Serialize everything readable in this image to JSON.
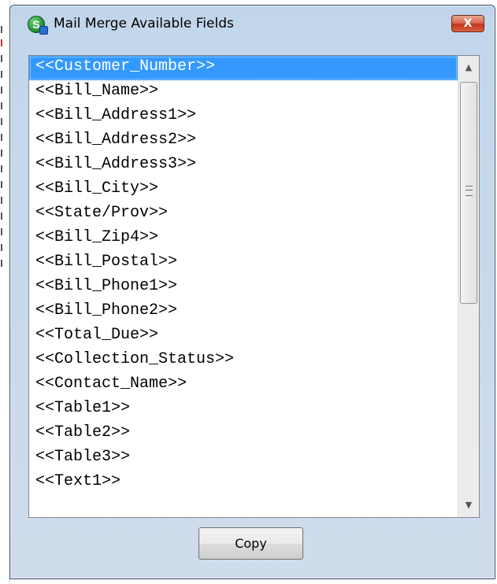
{
  "window": {
    "title": "Mail Merge Available Fields",
    "app_icon_letter": "S",
    "close_glyph": "X"
  },
  "fields": [
    "<<Customer_Number>>",
    "<<Bill_Name>>",
    "<<Bill_Address1>>",
    "<<Bill_Address2>>",
    "<<Bill_Address3>>",
    "<<Bill_City>>",
    "<<State/Prov>>",
    "<<Bill_Zip4>>",
    "<<Bill_Postal>>",
    "<<Bill_Phone1>>",
    "<<Bill_Phone2>>",
    "<<Total_Due>>",
    "<<Collection_Status>>",
    "<<Contact_Name>>",
    "<<Table1>>",
    "<<Table2>>",
    "<<Table3>>",
    "<<Text1>>"
  ],
  "selected_index": 0,
  "scrollbar": {
    "up_arrow": "▲",
    "down_arrow": "▼"
  },
  "copy_button": {
    "label": "Copy"
  },
  "colors": {
    "selection": "#3399ff",
    "close_button": "#c2361b"
  },
  "icons": {
    "app": "app-logo-icon",
    "close": "close-icon",
    "scroll_up": "scroll-up-arrow-icon",
    "scroll_down": "scroll-down-arrow-icon"
  }
}
